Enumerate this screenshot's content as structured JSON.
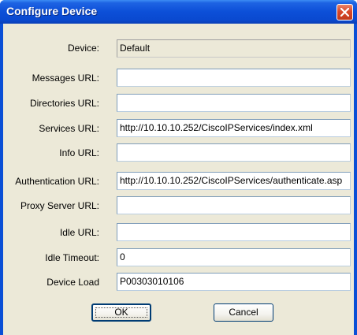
{
  "window": {
    "title": "Configure Device"
  },
  "icons": {
    "close": "close-icon"
  },
  "form": {
    "rows": [
      {
        "label": "Device:",
        "value": "Default"
      },
      {
        "label": "Messages URL:",
        "value": ""
      },
      {
        "label": "Directories URL:",
        "value": ""
      },
      {
        "label": "Services URL:",
        "value": "http://10.10.10.252/CiscoIPServices/index.xml"
      },
      {
        "label": "Info URL:",
        "value": ""
      },
      {
        "label": "Authentication URL:",
        "value": "http://10.10.10.252/CiscoIPServices/authenticate.asp"
      },
      {
        "label": "Proxy Server URL:",
        "value": ""
      },
      {
        "label": "Idle URL:",
        "value": ""
      },
      {
        "label": "Idle Timeout:",
        "value": "0"
      },
      {
        "label": "Device Load",
        "value": "P00303010106"
      }
    ]
  },
  "buttons": {
    "ok_label": "OK",
    "cancel_label": "Cancel"
  },
  "colors": {
    "titlebar": "#0a4fd6",
    "client_bg": "#ece9d8",
    "close_button": "#d8472a"
  }
}
